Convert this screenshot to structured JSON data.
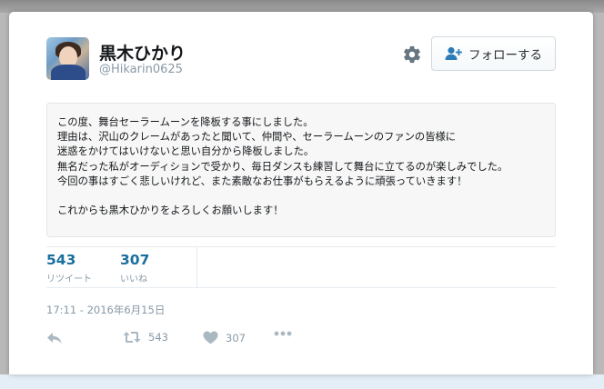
{
  "profile": {
    "display_name": "黒木ひかり",
    "handle": "@Hikarin0625"
  },
  "header": {
    "follow_label": "フォローする",
    "settings_icon": "gear-icon",
    "follow_icon": "add-user-icon"
  },
  "tweet": {
    "lines": [
      "この度、舞台セーラームーンを降板する事にしました。",
      "理由は、沢山のクレームがあったと聞いて、仲間や、セーラームーンのファンの皆様に",
      "迷惑をかけてはいけないと思い自分から降板しました。",
      "無名だった私がオーディションで受かり、毎日ダンスも練習して舞台に立てるのが楽しみでした。",
      "今回の事はすごく悲しいけれど、また素敵なお仕事がもらえるように頑張っていきます！",
      "",
      "これからも黒木ひかりをよろしくお願いします！"
    ]
  },
  "stats": {
    "retweets": {
      "count": "543",
      "label": "リツイート"
    },
    "likes": {
      "count": "307",
      "label": "いいね"
    }
  },
  "timestamp": "17:11 - 2016年6月15日",
  "actions": {
    "retweet_count": "543",
    "like_count": "307"
  },
  "colors": {
    "stat_number": "#1b6f9e",
    "muted": "#8899a6",
    "action_icon": "#aab8c2",
    "follow_icon": "#2b7bb9"
  }
}
